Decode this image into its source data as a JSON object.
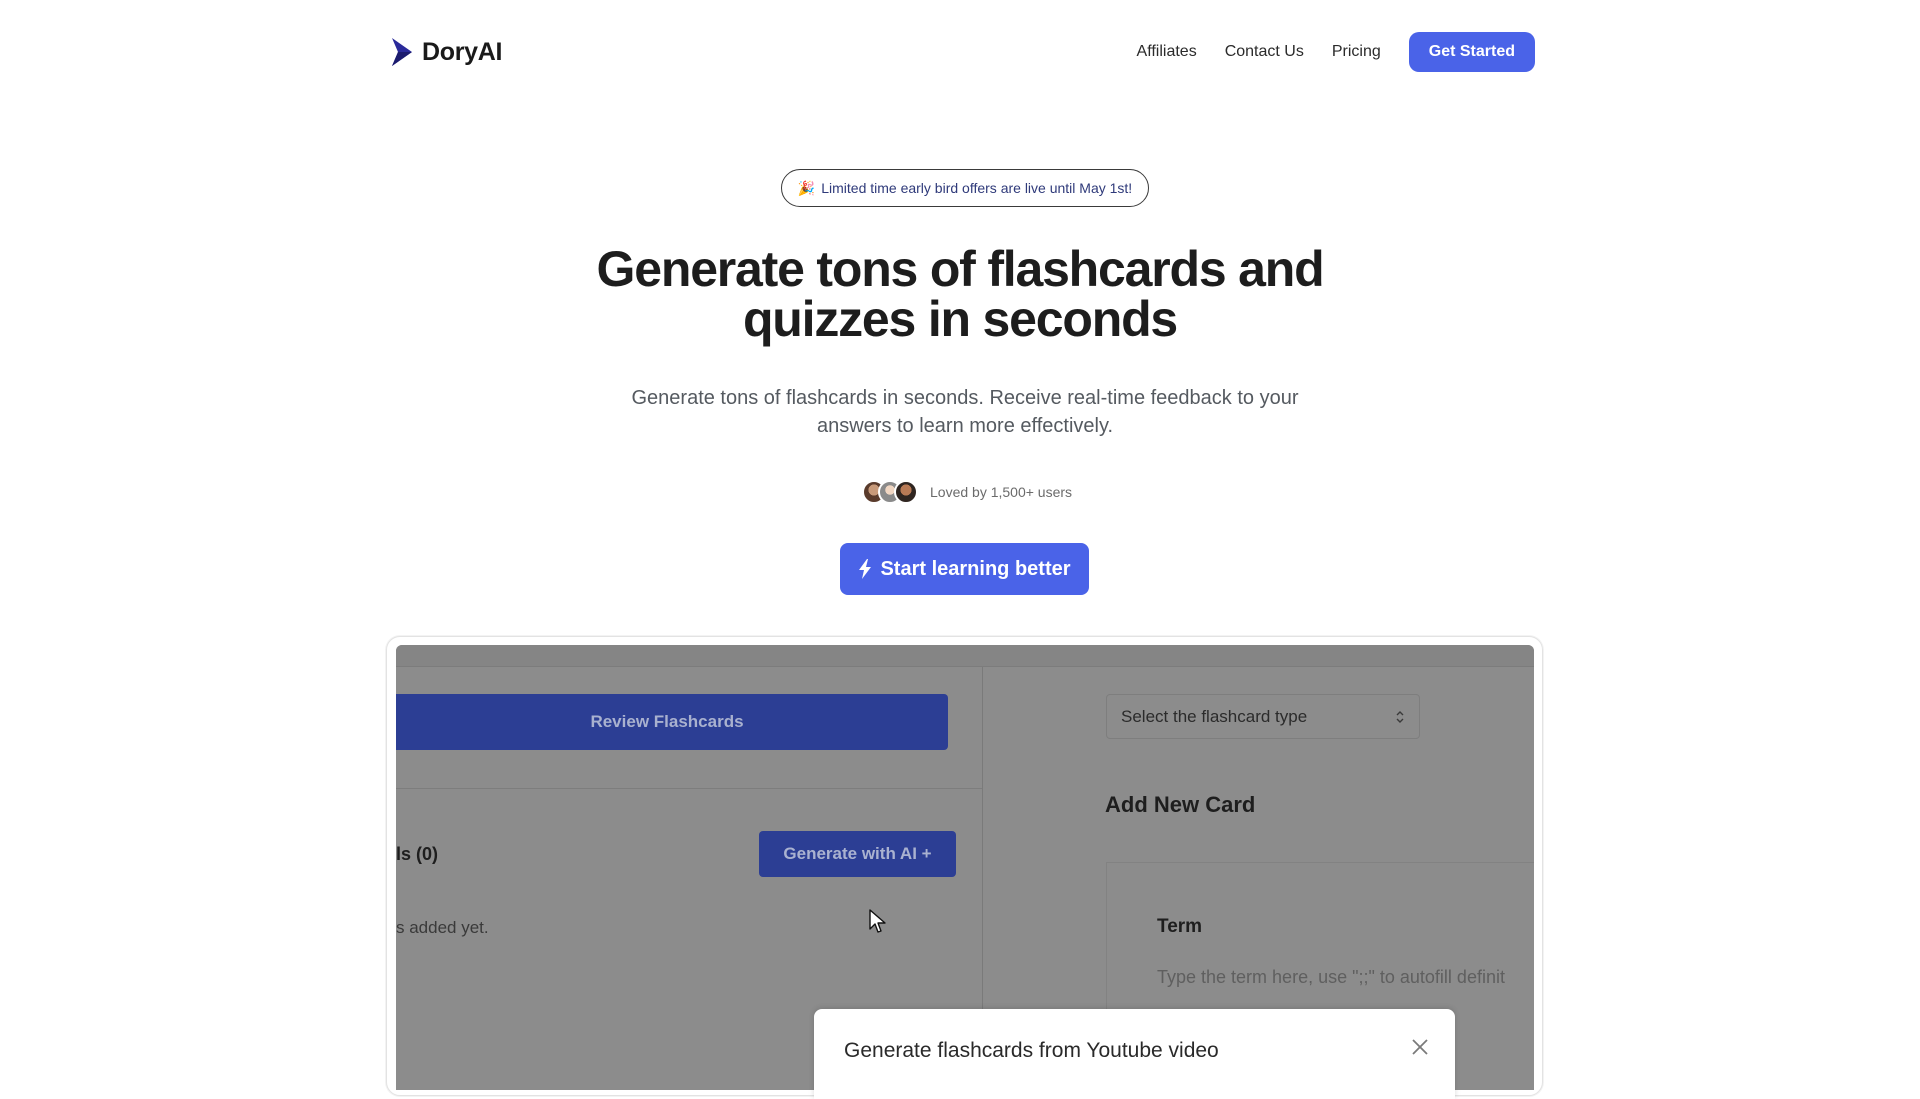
{
  "header": {
    "brand": "DoryAI",
    "nav": {
      "affiliates": "Affiliates",
      "contact": "Contact Us",
      "pricing": "Pricing"
    },
    "cta": "Get Started"
  },
  "hero": {
    "promo_emoji": "🎉",
    "promo_text": "Limited time early bird offers are live until May 1st!",
    "title_line1": "Generate tons of flashcards and",
    "title_line2": "quizzes in seconds",
    "subtitle_line1": "Generate tons of flashcards in seconds. Receive real-time feedback to your",
    "subtitle_line2": "answers to learn more effectively.",
    "social_proof": "Loved by 1,500+ users",
    "cta": "Start learning better"
  },
  "preview": {
    "review_button": "Review Flashcards",
    "cards_label": "ls (0)",
    "generate_button": "Generate with AI +",
    "empty_text": "s added yet.",
    "select_placeholder": "Select the flashcard type",
    "add_card_title": "Add New Card",
    "term_label": "Term",
    "term_placeholder": "Type the term here, use \";;\" to autofill definit",
    "modal_title": "Generate flashcards from Youtube video"
  },
  "colors": {
    "accent": "#4a63e8",
    "overlay": "#8c8c8c",
    "preview_button": "#2c3e94"
  },
  "icons": {
    "logo": "doryai-logo-icon",
    "bolt": "lightning-bolt-icon",
    "select": "chevron-up-down-icon",
    "close": "close-icon",
    "cursor": "mouse-pointer-icon"
  }
}
